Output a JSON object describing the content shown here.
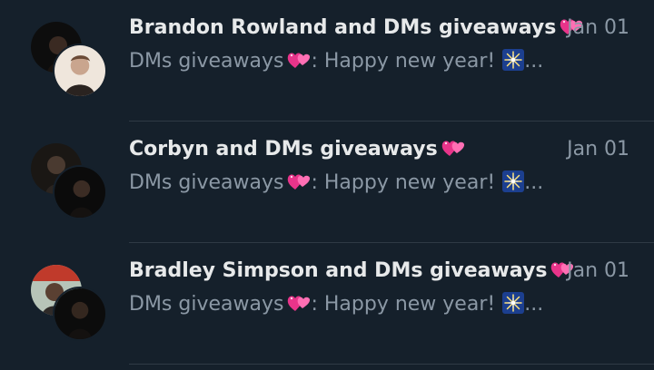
{
  "conversations": [
    {
      "title": "Brandon Rowland and DMs giveaways",
      "date": "Jan 01",
      "sender": "DMs giveaways",
      "message": ": Happy new year!",
      "ellipsis": "...",
      "title_emoji": "two-hearts-icon",
      "message_emoji": "sparkler-icon"
    },
    {
      "title": "Corbyn and DMs giveaways",
      "date": "Jan 01",
      "sender": "DMs giveaways",
      "message": ": Happy new year!",
      "ellipsis": "...",
      "title_emoji": "two-hearts-icon",
      "message_emoji": "sparkler-icon"
    },
    {
      "title": "Bradley Simpson and DMs giveaways",
      "date": "Jan 01",
      "sender": "DMs giveaways",
      "message": ": Happy new year!",
      "ellipsis": "...",
      "title_emoji": "two-hearts-icon",
      "message_emoji": "sparkler-icon"
    }
  ],
  "colors": {
    "background": "#15202b",
    "title": "#e7e9ea",
    "secondary": "#8b98a5",
    "divider": "#2f3a45",
    "heart": "#f24b9a"
  }
}
